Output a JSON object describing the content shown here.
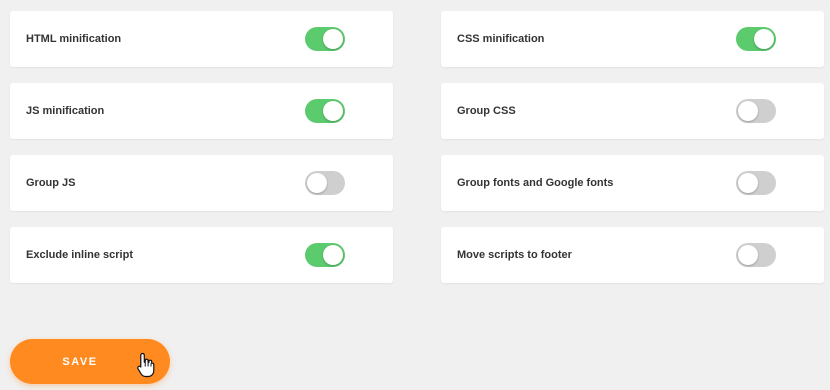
{
  "settings": [
    {
      "label": "HTML minification",
      "enabled": true
    },
    {
      "label": "CSS minification",
      "enabled": true
    },
    {
      "label": "JS minification",
      "enabled": true
    },
    {
      "label": "Group CSS",
      "enabled": false
    },
    {
      "label": "Group JS",
      "enabled": false
    },
    {
      "label": "Group fonts and Google fonts",
      "enabled": false
    },
    {
      "label": "Exclude inline script",
      "enabled": true
    },
    {
      "label": "Move scripts to footer",
      "enabled": false
    }
  ],
  "actions": {
    "save_label": "SAVE"
  },
  "colors": {
    "toggle_on": "#5ccb6e",
    "toggle_off": "#cfcfcf",
    "save_button": "#ff8a1f"
  },
  "icons": {
    "cursor": "hand-pointer-icon"
  }
}
